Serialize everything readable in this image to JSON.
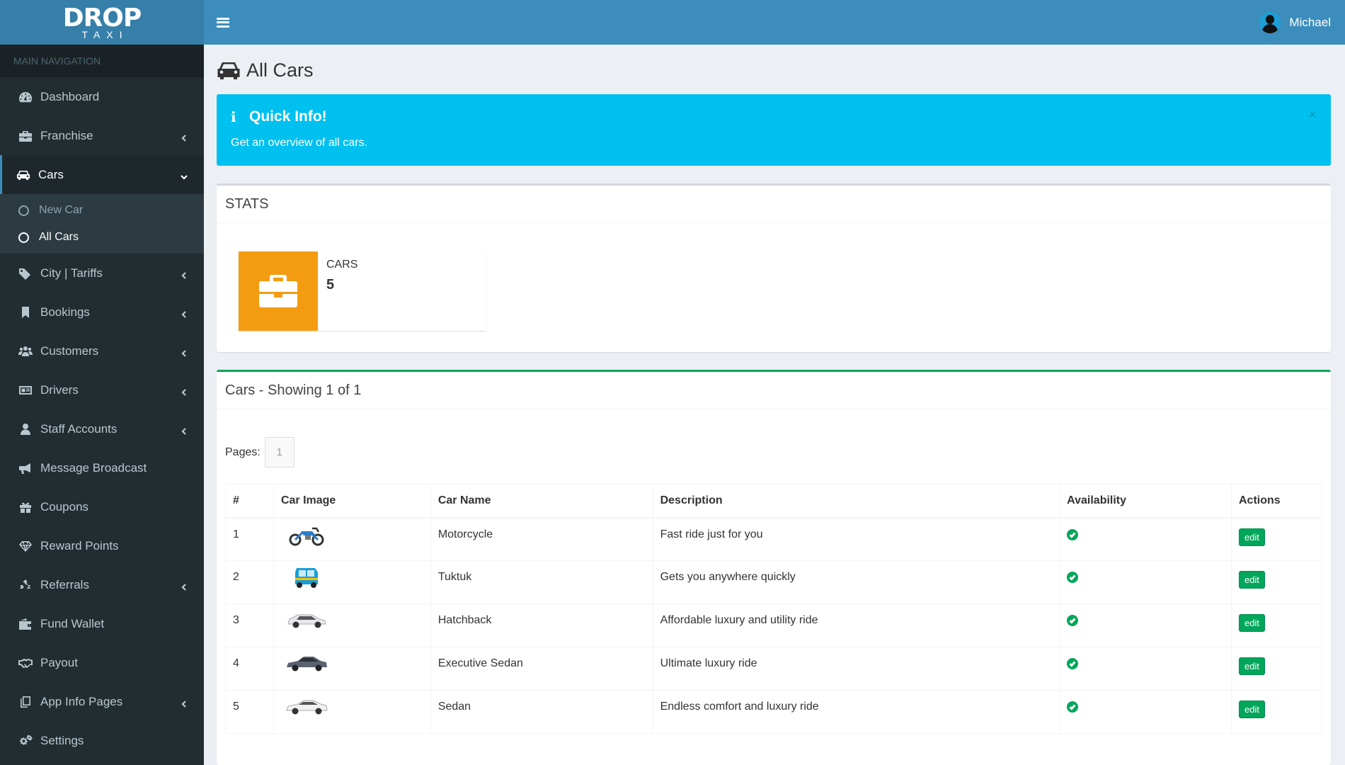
{
  "app": {
    "logo_main": "DROP",
    "logo_sub": "TAXI"
  },
  "sidebar": {
    "header": "MAIN NAVIGATION",
    "items": [
      {
        "label": "Dashboard",
        "icon": "dashboard-icon"
      },
      {
        "label": "Franchise",
        "icon": "briefcase-icon"
      },
      {
        "label": "Cars",
        "icon": "car-icon"
      },
      {
        "label": "City | Tariffs",
        "icon": "tags-icon"
      },
      {
        "label": "Bookings",
        "icon": "bookmark-icon"
      },
      {
        "label": "Customers",
        "icon": "users-icon"
      },
      {
        "label": "Drivers",
        "icon": "id-card-icon"
      },
      {
        "label": "Staff Accounts",
        "icon": "user-icon"
      },
      {
        "label": "Message Broadcast",
        "icon": "bullhorn-icon"
      },
      {
        "label": "Coupons",
        "icon": "gift-icon"
      },
      {
        "label": "Reward Points",
        "icon": "diamond-icon"
      },
      {
        "label": "Referrals",
        "icon": "recycle-icon"
      },
      {
        "label": "Fund Wallet",
        "icon": "wallet-icon"
      },
      {
        "label": "Payout",
        "icon": "handshake-icon"
      },
      {
        "label": "App Info Pages",
        "icon": "copy-icon"
      },
      {
        "label": "Settings",
        "icon": "cogs-icon"
      }
    ],
    "cars_sub": [
      {
        "label": "New Car"
      },
      {
        "label": "All Cars"
      }
    ]
  },
  "topbar": {
    "username": "Michael"
  },
  "page": {
    "title": "All Cars"
  },
  "callout": {
    "title": "Quick Info!",
    "text": "Get an overview of all cars.",
    "close": "×"
  },
  "stats": {
    "header": "STATS",
    "label": "CARS",
    "value": "5"
  },
  "cars": {
    "header": "Cars - Showing 1 of 1",
    "pages_label": "Pages:",
    "current_page": "1",
    "columns": [
      "#",
      "Car Image",
      "Car Name",
      "Description",
      "Availability",
      "Actions"
    ],
    "rows": [
      {
        "num": "1",
        "name": "Motorcycle",
        "desc": "Fast ride just for you",
        "action": "edit",
        "image": "motorcycle-image"
      },
      {
        "num": "2",
        "name": "Tuktuk",
        "desc": "Gets you anywhere quickly",
        "action": "edit",
        "image": "tuktuk-image"
      },
      {
        "num": "3",
        "name": "Hatchback",
        "desc": "Affordable luxury and utility ride",
        "action": "edit",
        "image": "hatchback-image"
      },
      {
        "num": "4",
        "name": "Executive Sedan",
        "desc": "Ultimate luxury ride",
        "action": "edit",
        "image": "executive-sedan-image"
      },
      {
        "num": "5",
        "name": "Sedan",
        "desc": "Endless comfort and luxury ride",
        "action": "edit",
        "image": "sedan-image"
      }
    ]
  },
  "colors": {
    "sidebar": "#222d32",
    "topbar": "#3c8dbc",
    "callout": "#00c0ef",
    "stat_icon": "#f39c12",
    "success": "#00a65a"
  }
}
